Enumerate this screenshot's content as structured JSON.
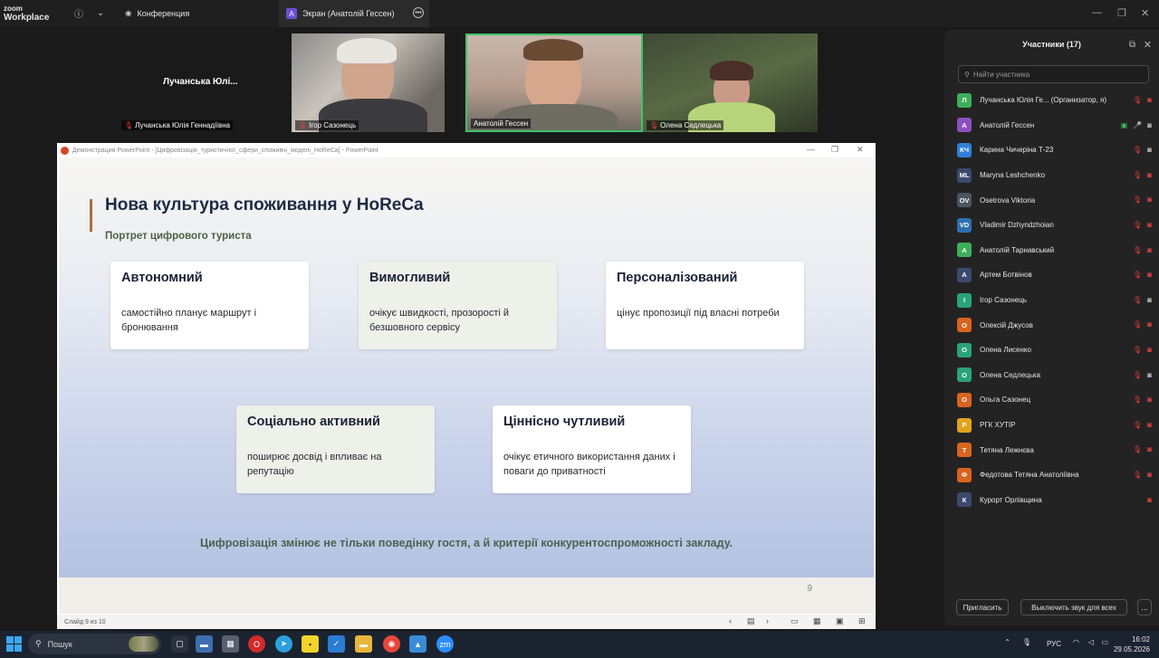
{
  "app": {
    "logo_line1": "zoom",
    "logo_line2": "Workplace"
  },
  "tabs": {
    "conference": "Конференция",
    "screen": "Экран (Анатолій Гессен)",
    "screen_badge": "A"
  },
  "videos": {
    "lu": {
      "big_name": "Лучанська  Юлі...",
      "label": "Лучанська Юлія Геннадіївна"
    },
    "ig": {
      "label": "Ігор Сазонець"
    },
    "an": {
      "label": "Анатолій Гессен"
    },
    "ol": {
      "label": "Олена Седлецька"
    }
  },
  "ppt": {
    "window_title": "Демонстрация PowerPoint - [Цифровізація_туристичної_сфери_споживчі_моделі_HoReCa] - PowerPoint",
    "status": "Слайд 9 из 10"
  },
  "slide": {
    "title": "Нова культура споживання у HoReCa",
    "subtitle": "Портрет цифрового туриста",
    "number": "9",
    "cards": [
      {
        "title": "Автономний",
        "text": "самостійно планує маршрут і бронювання"
      },
      {
        "title": "Вимогливий",
        "text": "очікує швидкості, прозорості й безшовного сервісу"
      },
      {
        "title": "Персоналізований",
        "text": "цінує пропозиції під власні потреби"
      },
      {
        "title": "Соціально активний",
        "text": "поширює досвід і впливає на репутацію"
      },
      {
        "title": "Ціннісно чутливий",
        "text": "очікує етичного використання даних і поваги до приватності"
      }
    ],
    "footer": "Цифровізація змінює не тільки поведінку гостя, а й критерії конкурентоспроможності закладу."
  },
  "panel": {
    "title": "Участники (17)",
    "search_placeholder": "Найти участника",
    "participants": [
      {
        "initials": "Л",
        "name": "Лучанська Юлія Ге...  (Организатор, я)",
        "color": "#3fae5a",
        "mic": "off",
        "cam": "off"
      },
      {
        "initials": "А",
        "name": "Анатолій Гессен",
        "color": "#8c4fc0",
        "mic": "on",
        "cam": "on",
        "share": true
      },
      {
        "initials": "КЧ",
        "name": "Карина Чичеріна Т-23",
        "color": "#2f7fd6",
        "mic": "off",
        "cam": "on"
      },
      {
        "initials": "ML",
        "name": "Maryna Leshchenko",
        "color": "#3a4a6e",
        "mic": "off",
        "cam": "off"
      },
      {
        "initials": "OV",
        "name": "Osetrova Viktoria",
        "color": "#4a5560",
        "mic": "off",
        "cam": "off"
      },
      {
        "initials": "VD",
        "name": "Vladimir Dzhyndzhoian",
        "color": "#2f6fb0",
        "mic": "off",
        "cam": "off"
      },
      {
        "initials": "А",
        "name": "Анатолій Тарнавський",
        "color": "#3fae5a",
        "mic": "off",
        "cam": "off"
      },
      {
        "initials": "А",
        "name": "Артем Ботвінов",
        "color": "#3a4a6e",
        "mic": "off",
        "cam": "off"
      },
      {
        "initials": "І",
        "name": "Ігор Сазонець",
        "color": "#29a37a",
        "mic": "off",
        "cam": "on"
      },
      {
        "initials": "О",
        "name": "Олексій Джусов",
        "color": "#d9641e",
        "mic": "off",
        "cam": "off"
      },
      {
        "initials": "О",
        "name": "Олена Лисенко",
        "color": "#29a37a",
        "mic": "off",
        "cam": "off"
      },
      {
        "initials": "О",
        "name": "Олена Седлецька",
        "color": "#29a37a",
        "mic": "off",
        "cam": "on"
      },
      {
        "initials": "О",
        "name": "Ольга Сазонец",
        "color": "#d9641e",
        "mic": "off",
        "cam": "off"
      },
      {
        "initials": "Р",
        "name": "РГК ХУТІР",
        "color": "#e0a41c",
        "mic": "off",
        "cam": "off"
      },
      {
        "initials": "Т",
        "name": "Тетяна Лежнєва",
        "color": "#d9641e",
        "mic": "off",
        "cam": "off"
      },
      {
        "initials": "Ф",
        "name": "Федотова Тетяна Анатоліївна",
        "color": "#d9641e",
        "mic": "off",
        "cam": "off"
      },
      {
        "initials": "К",
        "name": "Курорт Орлівщина",
        "color": "#3a4a6e",
        "mic": "none",
        "cam": "off"
      }
    ],
    "invite": "Пригласить",
    "mute_all": "Выключить звук для всех",
    "more": "..."
  },
  "taskbar": {
    "search": "Пошук",
    "lang": "РУС",
    "time": "16:02",
    "date": "29.05.2026"
  }
}
